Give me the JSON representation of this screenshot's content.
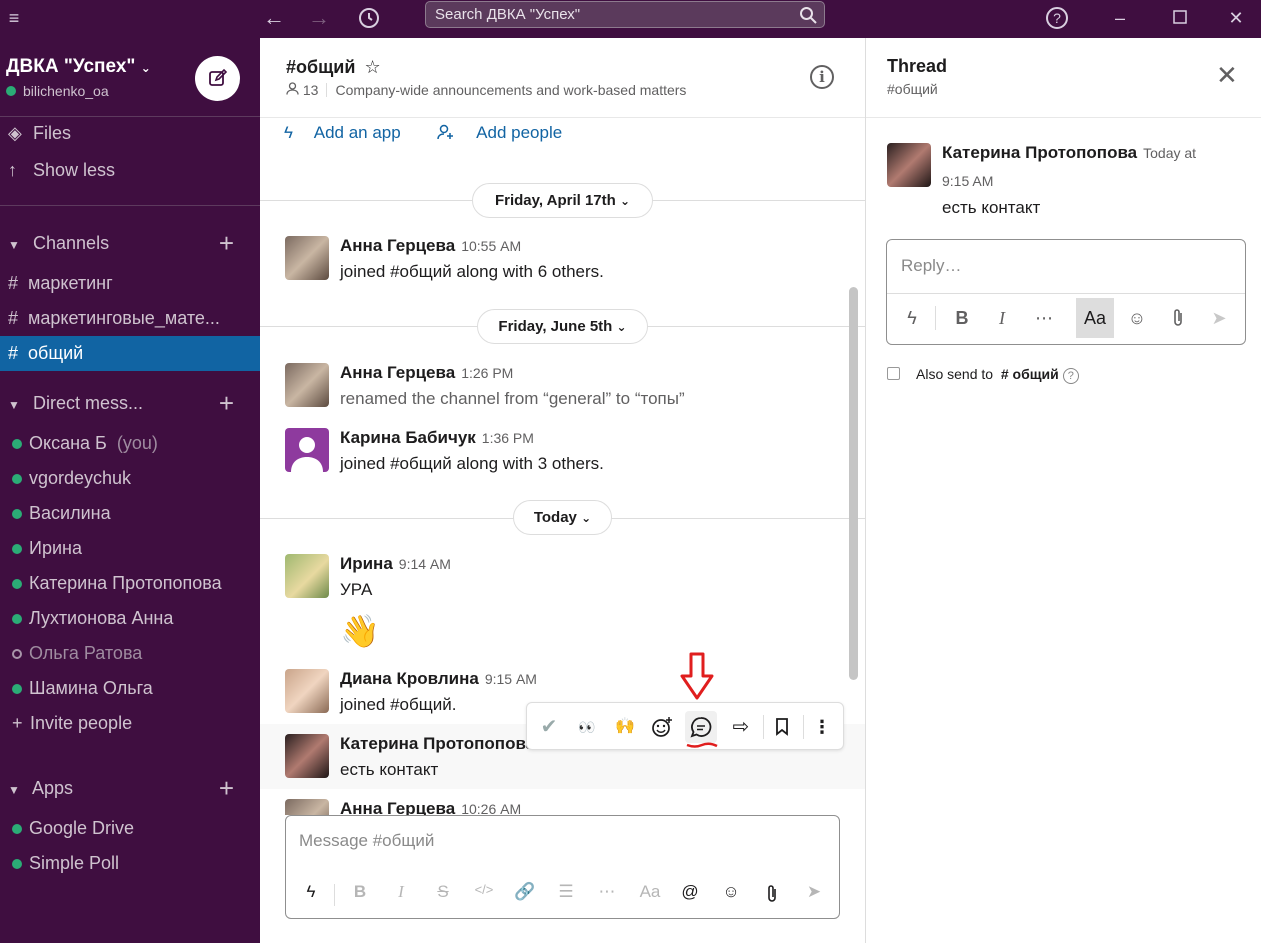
{
  "topbar": {
    "search_placeholder": "Search ДВКА \"Успех\""
  },
  "workspace": {
    "name": "ДВКА \"Успех\"",
    "user": "bilichenko_oa"
  },
  "sidebar": {
    "files": "Files",
    "show_less": "Show less",
    "channels_header": "Channels",
    "channels": [
      "маркетинг",
      "маркетинговые_мате...",
      "общий"
    ],
    "dm_header": "Direct mess...",
    "dms": [
      {
        "name": "Оксана Б",
        "suffix": "(you)"
      },
      {
        "name": "vgordeychuk"
      },
      {
        "name": "Василина"
      },
      {
        "name": "Ирина"
      },
      {
        "name": "Катерина Протопопова"
      },
      {
        "name": "Лухтионова Анна"
      },
      {
        "name": "Ольга Ратова",
        "away": true
      },
      {
        "name": "Шамина Ольга"
      }
    ],
    "invite": "Invite people",
    "apps_header": "Apps",
    "apps": [
      "Google Drive",
      "Simple Poll"
    ]
  },
  "channel": {
    "title": "#общий",
    "members": "13",
    "topic": "Company-wide announcements and work-based matters",
    "add_app": "Add an app",
    "add_people": "Add people"
  },
  "days": [
    "Friday, April 17th",
    "Friday, June 5th",
    "Today"
  ],
  "messages": [
    {
      "name": "Анна Герцева",
      "time": "10:55 AM",
      "text": "joined #общий along with 6 others."
    },
    {
      "name": "Анна Герцева",
      "time": "1:26 PM",
      "text": "renamed the channel from “general” to “топы”"
    },
    {
      "name": "Карина Бабичук",
      "time": "1:36 PM",
      "text": "joined #общий along with 3 others."
    },
    {
      "name": "Ирина",
      "time": "9:14 AM",
      "text": "УРА",
      "emoji": "👋"
    },
    {
      "name": "Диана Кровлина",
      "time": "9:15 AM",
      "text": "joined #общий."
    },
    {
      "name": "Катерина Протопопова",
      "time": "",
      "text": "есть контакт"
    },
    {
      "name": "Анна Герцева",
      "time": "10:26 AM",
      "text": ""
    }
  ],
  "composer": {
    "placeholder": "Message #общий"
  },
  "thread": {
    "title": "Thread",
    "subtitle": "#общий",
    "message": {
      "name": "Катерина Протопопова",
      "time_a": "Today at",
      "time_b": "9:15 AM",
      "text": "есть контакт"
    },
    "reply_placeholder": "Reply…",
    "also_send": "Also send to",
    "also_channel": "# общий"
  },
  "colors": {
    "sidebar_bg": "#3f0e40",
    "selected": "#1164a3",
    "link": "#1264a3",
    "presence": "#2bac76",
    "annotation": "#e01e1e"
  }
}
